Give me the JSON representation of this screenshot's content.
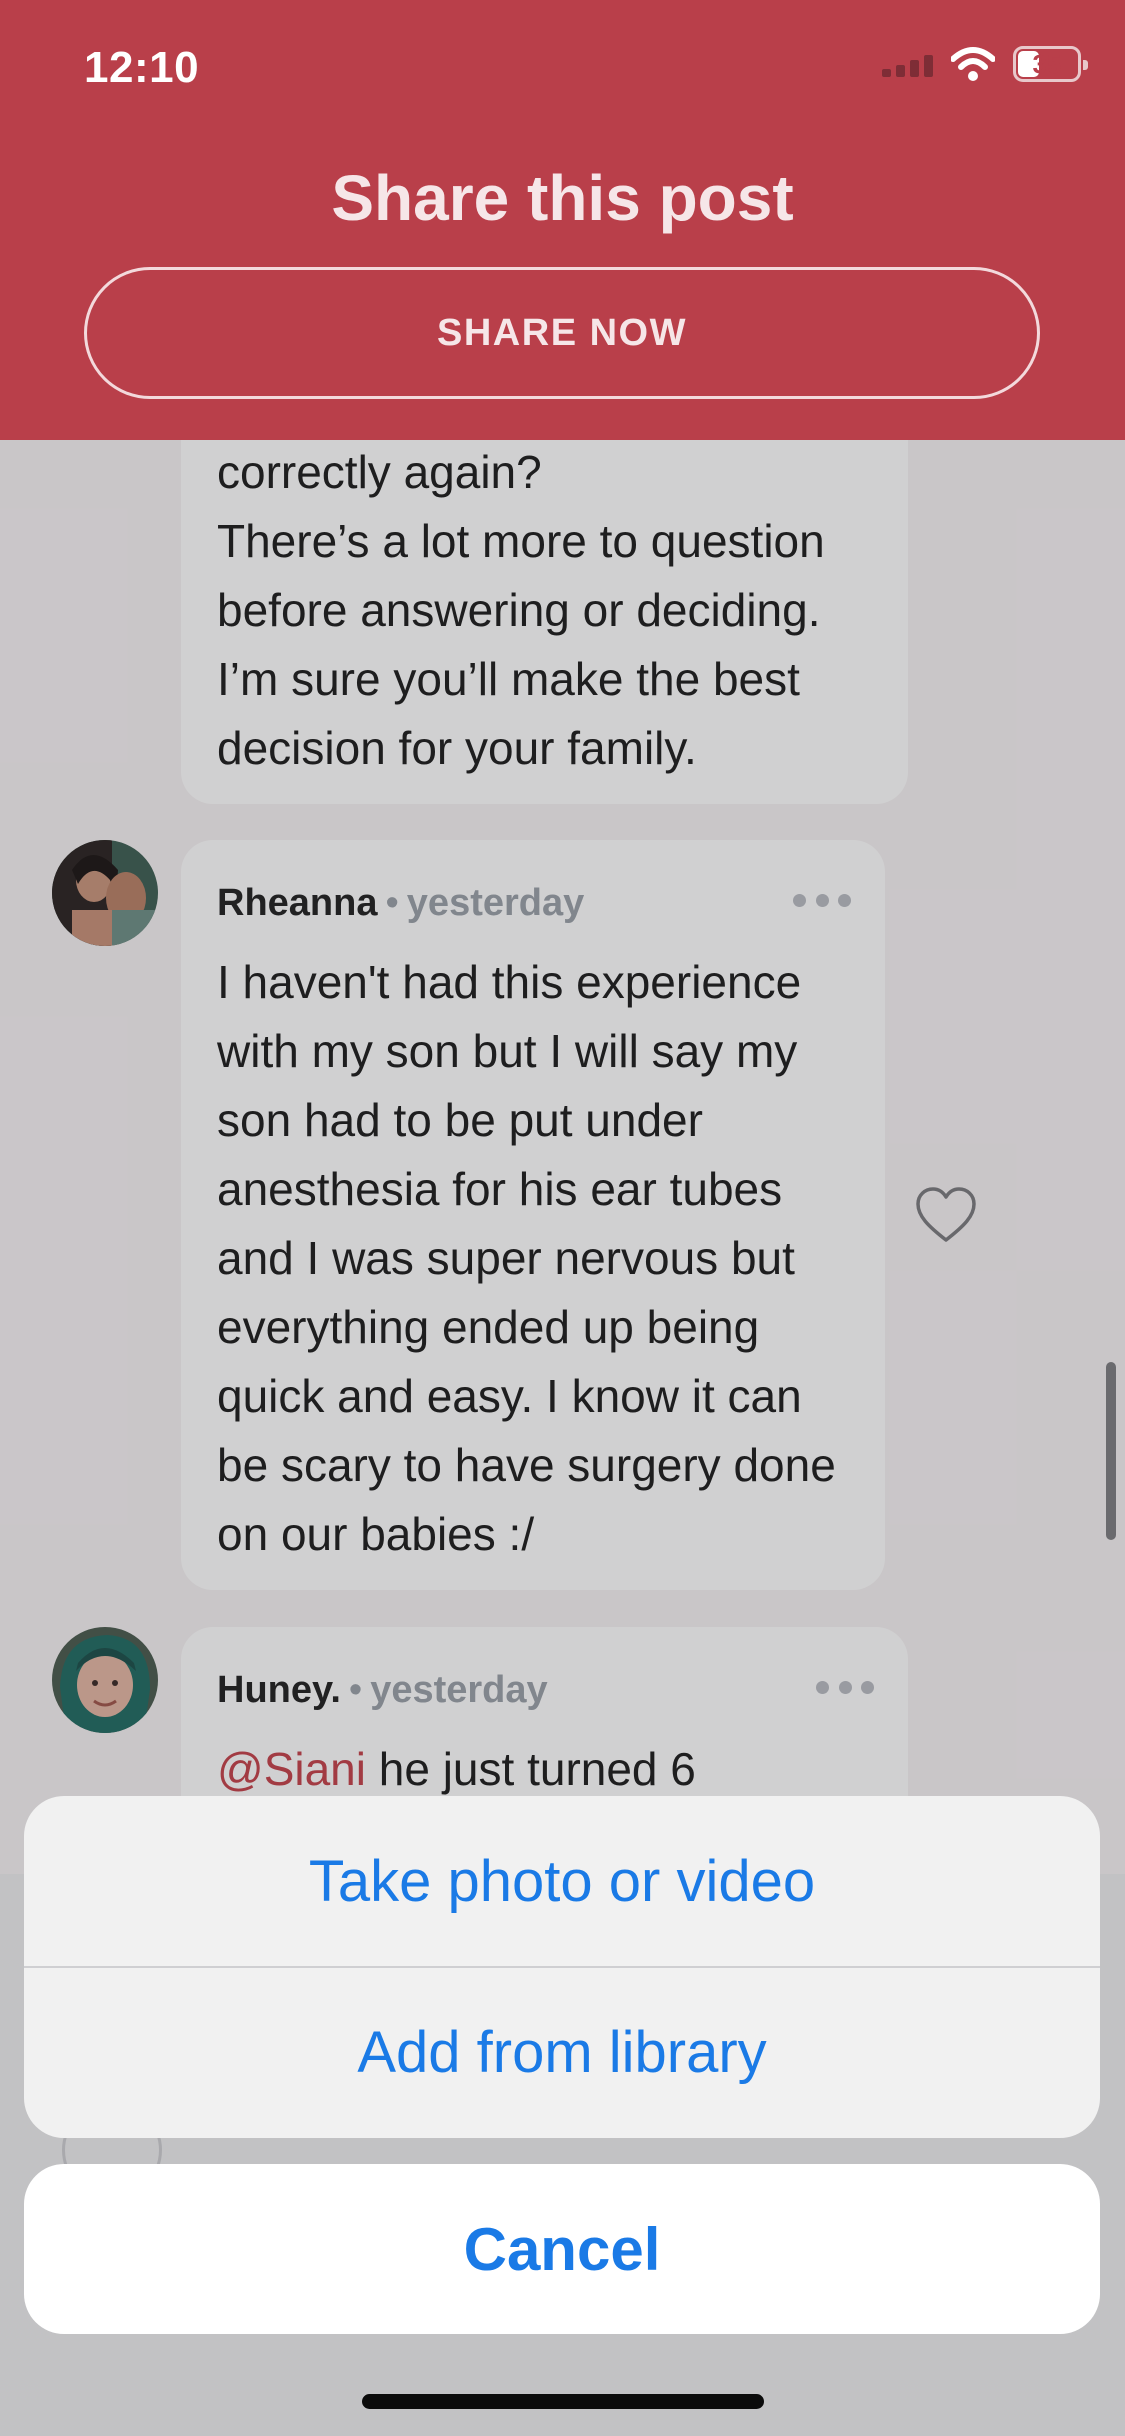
{
  "status_bar": {
    "time": "12:10",
    "battery": "35",
    "icons": [
      "cellular-signal-icon",
      "wifi-icon",
      "battery-icon"
    ]
  },
  "header": {
    "title": "Share this post",
    "share_button": "SHARE NOW"
  },
  "comments": [
    {
      "text": "correctly again?\nThere’s a lot more to question before answering or deciding. I’m sure you’ll make the best decision for your family."
    },
    {
      "author": "Rheanna",
      "separator": "•",
      "time": "yesterday",
      "text": "I haven't had this experience with my son but I will say my son had to be put under anesthesia for his ear tubes and I was super nervous but everything ended up being quick and easy. I know it can be scary to have surgery done on our babies :/"
    },
    {
      "author": "Huney.",
      "separator": "•",
      "time": "yesterday",
      "mention": "@Siani",
      "text": " he just turned 6"
    }
  ],
  "action_sheet": {
    "options": [
      "Take photo or video",
      "Add from library"
    ],
    "cancel": "Cancel"
  },
  "colors": {
    "header_red": "#b93f4a",
    "action_blue": "#1a7ae6",
    "mention_red": "#c4414a"
  }
}
